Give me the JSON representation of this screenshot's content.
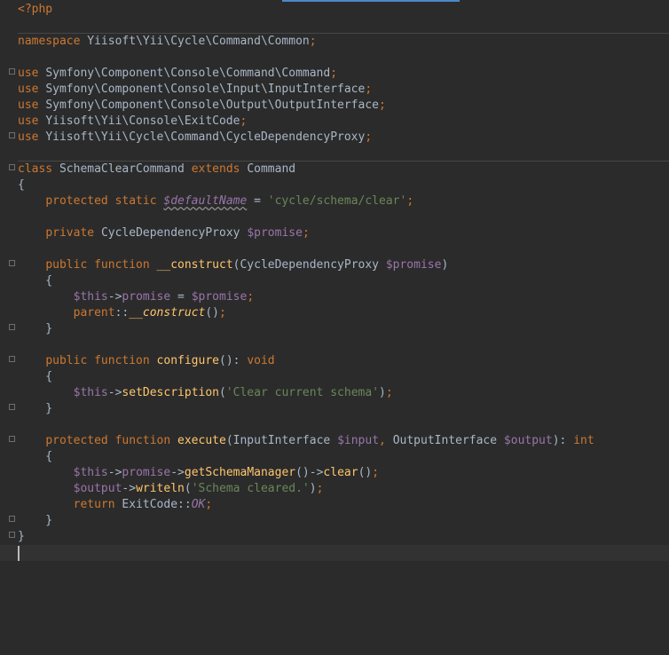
{
  "editor": {
    "language": "php",
    "lines": [
      [
        {
          "c": "tag",
          "t": "<?php"
        }
      ],
      [],
      [
        {
          "c": "k",
          "t": "namespace "
        },
        {
          "c": "t",
          "t": "Yiisoft\\Yii\\Cycle\\Command\\Common"
        },
        {
          "c": "k",
          "t": ";"
        }
      ],
      [],
      [
        {
          "c": "k",
          "t": "use "
        },
        {
          "c": "t",
          "t": "Symfony\\Component\\Console\\Command\\Command"
        },
        {
          "c": "k",
          "t": ";"
        }
      ],
      [
        {
          "c": "k",
          "t": "use "
        },
        {
          "c": "t",
          "t": "Symfony\\Component\\Console\\Input\\InputInterface"
        },
        {
          "c": "k",
          "t": ";"
        }
      ],
      [
        {
          "c": "k",
          "t": "use "
        },
        {
          "c": "t",
          "t": "Symfony\\Component\\Console\\Output\\OutputInterface"
        },
        {
          "c": "k",
          "t": ";"
        }
      ],
      [
        {
          "c": "k",
          "t": "use "
        },
        {
          "c": "t",
          "t": "Yiisoft\\Yii\\Console\\ExitCode"
        },
        {
          "c": "k",
          "t": ";"
        }
      ],
      [
        {
          "c": "k",
          "t": "use "
        },
        {
          "c": "t",
          "t": "Yiisoft\\Yii\\Cycle\\Command\\CycleDependencyProxy"
        },
        {
          "c": "k",
          "t": ";"
        }
      ],
      [],
      [
        {
          "c": "k",
          "t": "class "
        },
        {
          "c": "t",
          "t": "SchemaClearCommand "
        },
        {
          "c": "k",
          "t": "extends "
        },
        {
          "c": "t",
          "t": "Command"
        }
      ],
      [
        {
          "c": "t",
          "t": "{"
        }
      ],
      [
        {
          "c": "t",
          "t": "    "
        },
        {
          "c": "k",
          "t": "protected static "
        },
        {
          "c": "vu",
          "t": "$defaultName"
        },
        {
          "c": "t",
          "t": " = "
        },
        {
          "c": "s",
          "t": "'cycle/schema/clear'"
        },
        {
          "c": "k",
          "t": ";"
        }
      ],
      [],
      [
        {
          "c": "t",
          "t": "    "
        },
        {
          "c": "k",
          "t": "private "
        },
        {
          "c": "t",
          "t": "CycleDependencyProxy "
        },
        {
          "c": "v",
          "t": "$promise"
        },
        {
          "c": "k",
          "t": ";"
        }
      ],
      [],
      [
        {
          "c": "t",
          "t": "    "
        },
        {
          "c": "k",
          "t": "public function "
        },
        {
          "c": "f",
          "t": "__construct"
        },
        {
          "c": "t",
          "t": "(CycleDependencyProxy "
        },
        {
          "c": "v",
          "t": "$promise"
        },
        {
          "c": "t",
          "t": ")"
        }
      ],
      [
        {
          "c": "t",
          "t": "    {"
        }
      ],
      [
        {
          "c": "t",
          "t": "        "
        },
        {
          "c": "v",
          "t": "$this"
        },
        {
          "c": "t",
          "t": "->"
        },
        {
          "c": "v",
          "t": "promise"
        },
        {
          "c": "t",
          "t": " = "
        },
        {
          "c": "v",
          "t": "$promise"
        },
        {
          "c": "k",
          "t": ";"
        }
      ],
      [
        {
          "c": "t",
          "t": "        "
        },
        {
          "c": "k",
          "t": "parent"
        },
        {
          "c": "t",
          "t": "::"
        },
        {
          "c": "fi",
          "t": "__construct"
        },
        {
          "c": "t",
          "t": "()"
        },
        {
          "c": "k",
          "t": ";"
        }
      ],
      [
        {
          "c": "t",
          "t": "    }"
        }
      ],
      [],
      [
        {
          "c": "t",
          "t": "    "
        },
        {
          "c": "k",
          "t": "public function "
        },
        {
          "c": "f",
          "t": "configure"
        },
        {
          "c": "t",
          "t": "(): "
        },
        {
          "c": "k",
          "t": "void"
        }
      ],
      [
        {
          "c": "t",
          "t": "    {"
        }
      ],
      [
        {
          "c": "t",
          "t": "        "
        },
        {
          "c": "v",
          "t": "$this"
        },
        {
          "c": "t",
          "t": "->"
        },
        {
          "c": "f",
          "t": "setDescription"
        },
        {
          "c": "t",
          "t": "("
        },
        {
          "c": "s",
          "t": "'Clear current schema'"
        },
        {
          "c": "t",
          "t": ")"
        },
        {
          "c": "k",
          "t": ";"
        }
      ],
      [
        {
          "c": "t",
          "t": "    }"
        }
      ],
      [],
      [
        {
          "c": "t",
          "t": "    "
        },
        {
          "c": "k",
          "t": "protected function "
        },
        {
          "c": "f",
          "t": "execute"
        },
        {
          "c": "t",
          "t": "(InputInterface "
        },
        {
          "c": "v",
          "t": "$input"
        },
        {
          "c": "k",
          "t": ", "
        },
        {
          "c": "t",
          "t": "OutputInterface "
        },
        {
          "c": "v",
          "t": "$output"
        },
        {
          "c": "t",
          "t": "): "
        },
        {
          "c": "k",
          "t": "int"
        }
      ],
      [
        {
          "c": "t",
          "t": "    {"
        }
      ],
      [
        {
          "c": "t",
          "t": "        "
        },
        {
          "c": "v",
          "t": "$this"
        },
        {
          "c": "t",
          "t": "->"
        },
        {
          "c": "v",
          "t": "promise"
        },
        {
          "c": "t",
          "t": "->"
        },
        {
          "c": "f",
          "t": "getSchemaManager"
        },
        {
          "c": "t",
          "t": "()->"
        },
        {
          "c": "f",
          "t": "clear"
        },
        {
          "c": "t",
          "t": "()"
        },
        {
          "c": "k",
          "t": ";"
        }
      ],
      [
        {
          "c": "t",
          "t": "        "
        },
        {
          "c": "v",
          "t": "$output"
        },
        {
          "c": "t",
          "t": "->"
        },
        {
          "c": "f",
          "t": "writeln"
        },
        {
          "c": "t",
          "t": "("
        },
        {
          "c": "s",
          "t": "'Schema cleared.'"
        },
        {
          "c": "t",
          "t": ")"
        },
        {
          "c": "k",
          "t": ";"
        }
      ],
      [
        {
          "c": "t",
          "t": "        "
        },
        {
          "c": "k",
          "t": "return "
        },
        {
          "c": "t",
          "t": "ExitCode::"
        },
        {
          "c": "vi",
          "t": "OK"
        },
        {
          "c": "k",
          "t": ";"
        }
      ],
      [
        {
          "c": "t",
          "t": "    }"
        }
      ],
      [
        {
          "c": "t",
          "t": "}"
        }
      ],
      []
    ]
  }
}
